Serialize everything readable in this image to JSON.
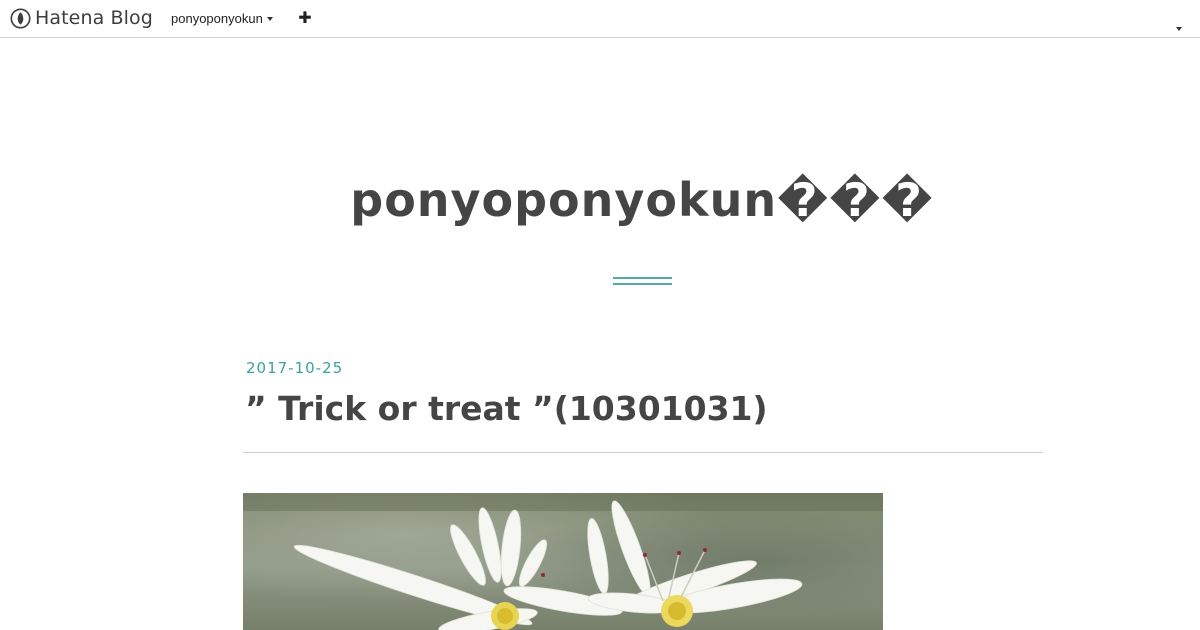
{
  "topbar": {
    "brand": "Hatena Blog",
    "user": "ponyoponyokun",
    "plus_icon": "plus-icon",
    "menu_icon": "caret-down-icon"
  },
  "blog": {
    "title": "ponyoponyokun���"
  },
  "entry": {
    "date": "2017-10-25",
    "title": "” Trick or treat ”(10301031)"
  },
  "colors": {
    "accent": "#3aa1a0",
    "text": "#454545",
    "divider": "#cfcfcf"
  }
}
